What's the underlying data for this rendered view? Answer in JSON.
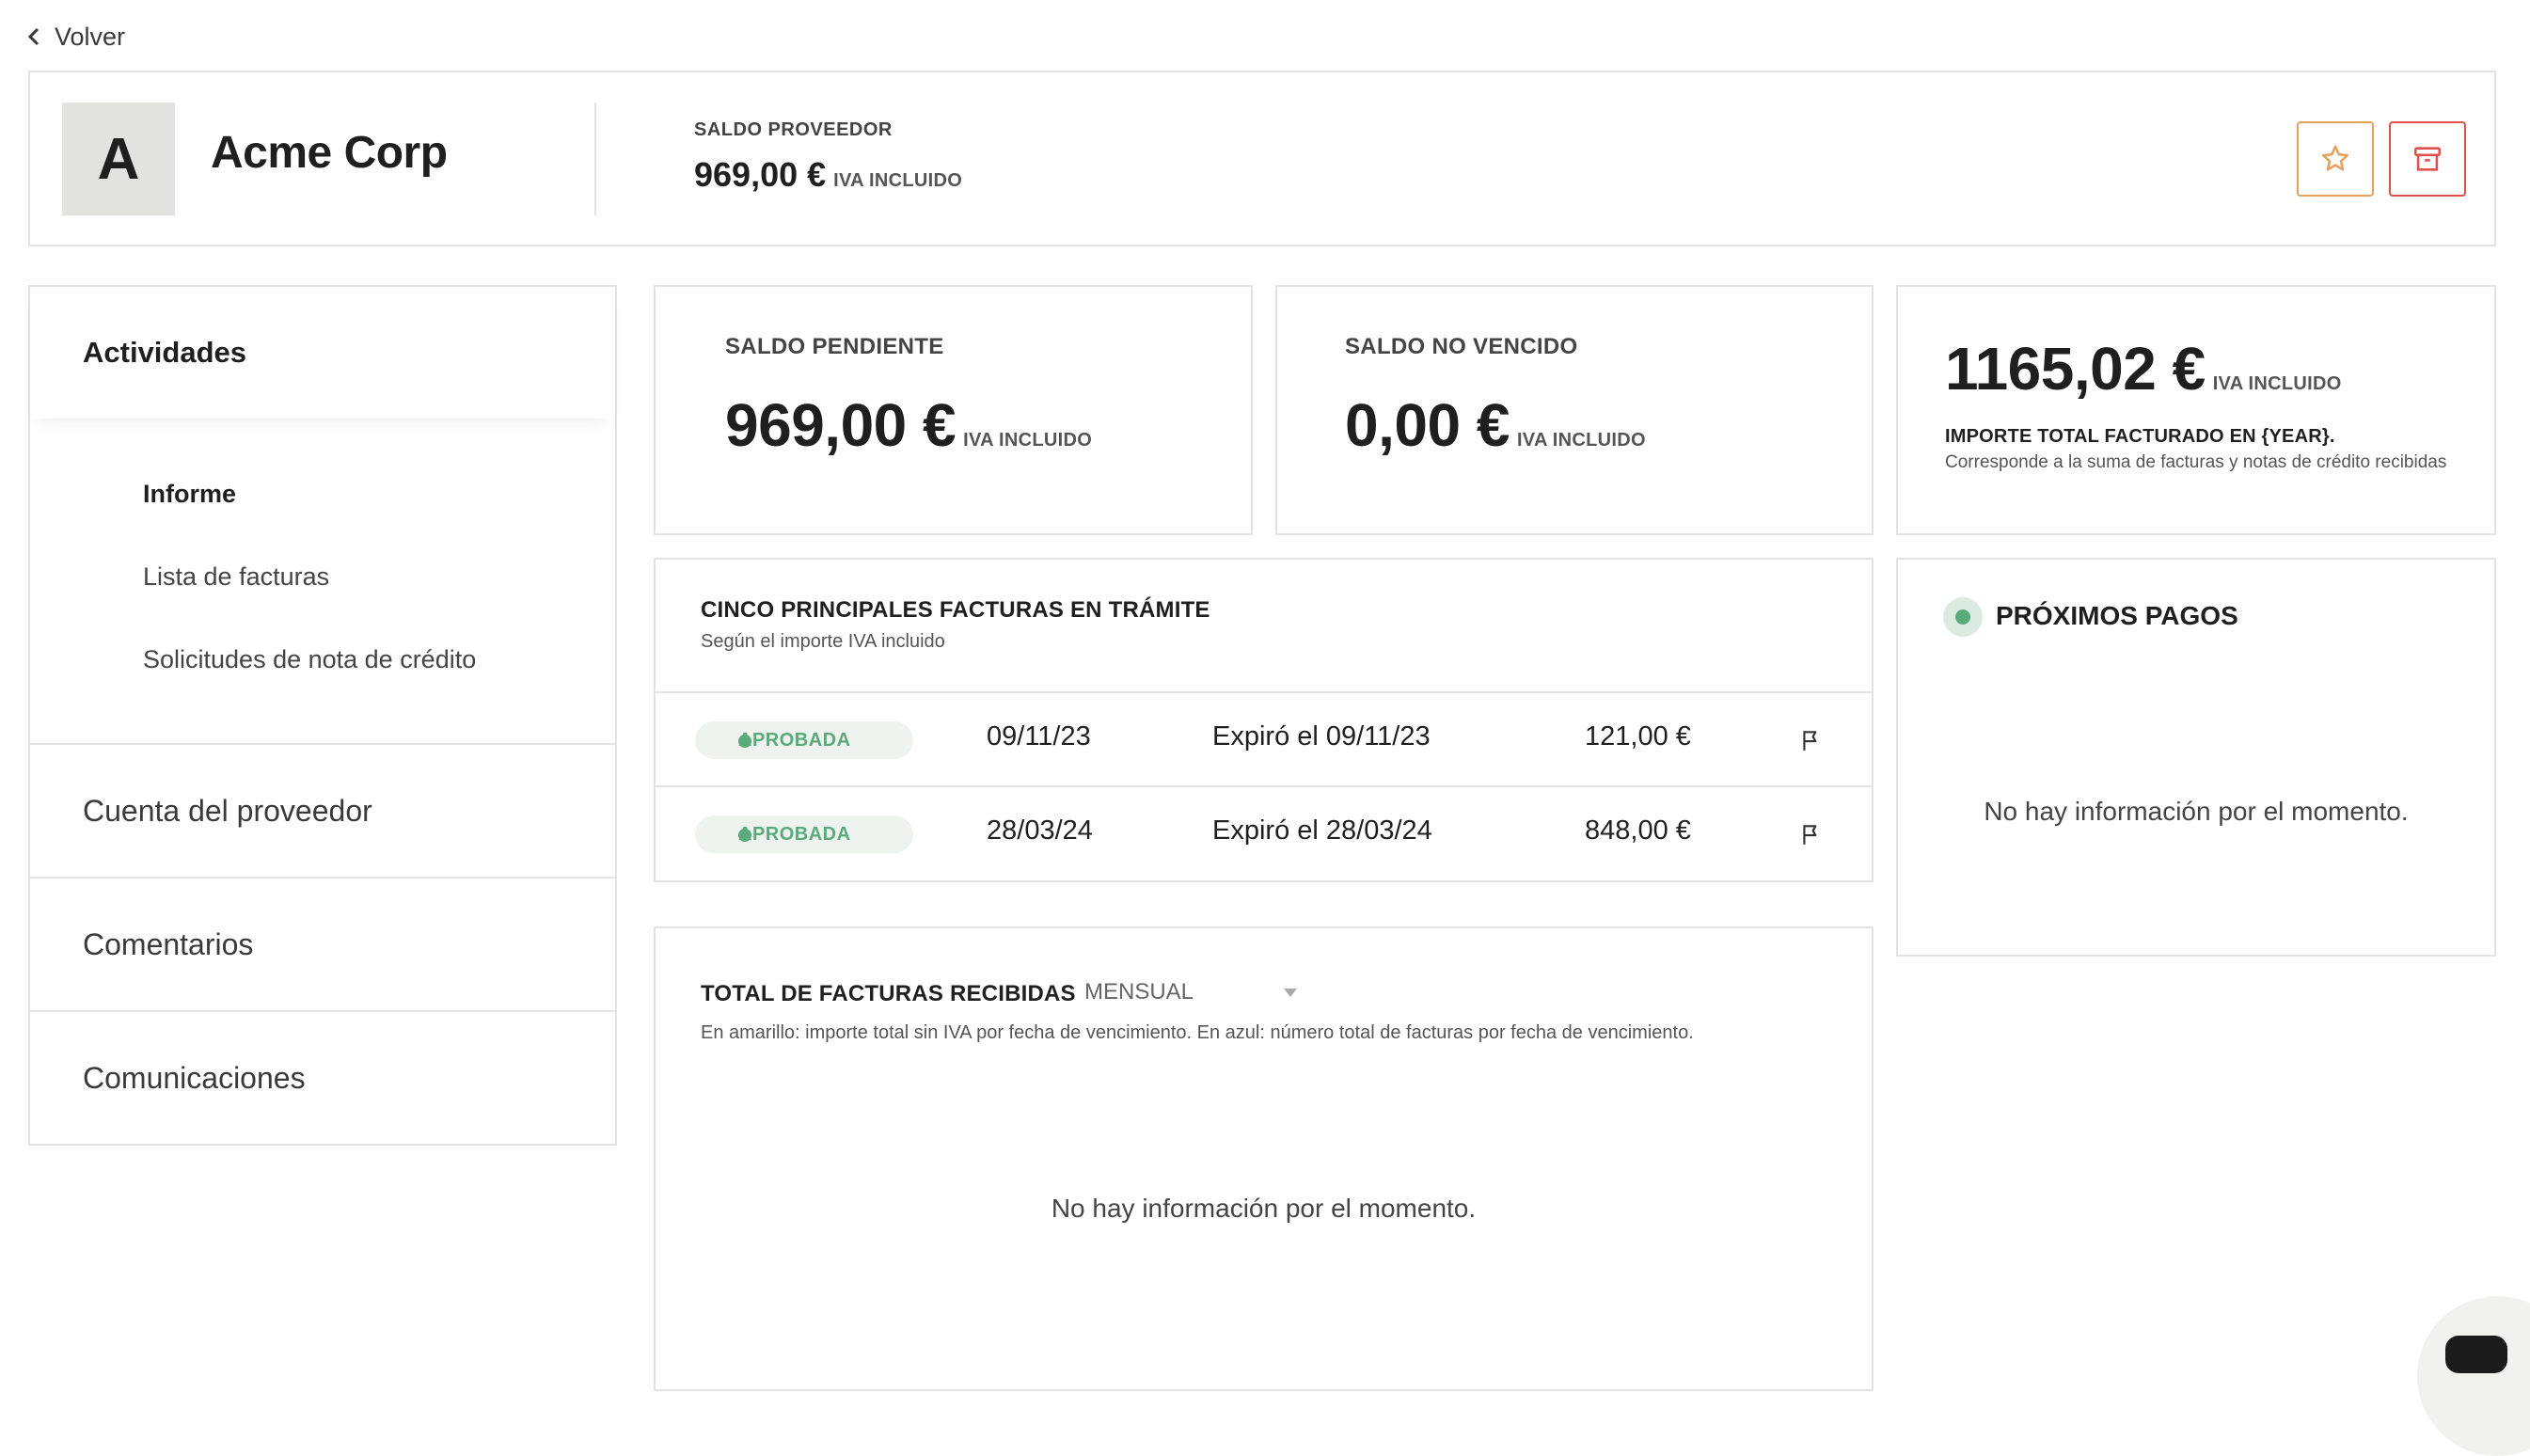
{
  "nav": {
    "back_label": "Volver"
  },
  "header": {
    "avatar_letter": "A",
    "company_name": "Acme Corp",
    "saldo_label": "SALDO PROVEEDOR",
    "saldo_value": "969,00 €",
    "saldo_suffix": "IVA INCLUIDO"
  },
  "sidebar": {
    "section_active": "Actividades",
    "sub_items": [
      "Informe",
      "Lista de facturas",
      "Solicitudes de nota de crédito"
    ],
    "sections": [
      "Cuenta del proveedor",
      "Comentarios",
      "Comunicaciones"
    ]
  },
  "stats": {
    "pending": {
      "label": "SALDO PENDIENTE",
      "value": "969,00 €",
      "suffix": "IVA INCLUIDO"
    },
    "not_due": {
      "label": "SALDO NO VENCIDO",
      "value": "0,00 €",
      "suffix": "IVA INCLUIDO"
    },
    "total": {
      "value": "1165,02 €",
      "suffix": "IVA INCLUIDO",
      "label_prefix": "IMPORTE TOTAL FACTURADO EN {",
      "label_year": "YEAR",
      "label_suffix": "}.",
      "description": "Corresponde a la suma de facturas y notas de crédito recibidas"
    }
  },
  "top_invoices": {
    "title": "CINCO PRINCIPALES FACTURAS EN TRÁMITE",
    "subtitle": "Según el importe IVA incluido",
    "rows": [
      {
        "status": "APROBADA",
        "date": "09/11/23",
        "due": "Expiró el 09/11/23",
        "amount": "121,00 €"
      },
      {
        "status": "APROBADA",
        "date": "28/03/24",
        "due": "Expiró el 28/03/24",
        "amount": "848,00 €"
      }
    ]
  },
  "received_chart": {
    "title": "TOTAL DE FACTURAS RECIBIDAS",
    "period": "MENSUAL",
    "description": "En amarillo: importe total sin IVA por fecha de vencimiento. En azul: número total de facturas por fecha de vencimiento.",
    "empty_text": "No hay información por el momento."
  },
  "next_payments": {
    "title": "PRÓXIMOS PAGOS",
    "empty_text": "No hay información por el momento."
  },
  "colors": {
    "approved_green": "#5aab7c",
    "star_orange": "#e6a15f",
    "archive_red": "#e0514b",
    "border": "#e3e3e1"
  },
  "icons": [
    "chevron-left-icon",
    "star-icon",
    "archive-icon",
    "flag-icon",
    "chat-icon"
  ]
}
